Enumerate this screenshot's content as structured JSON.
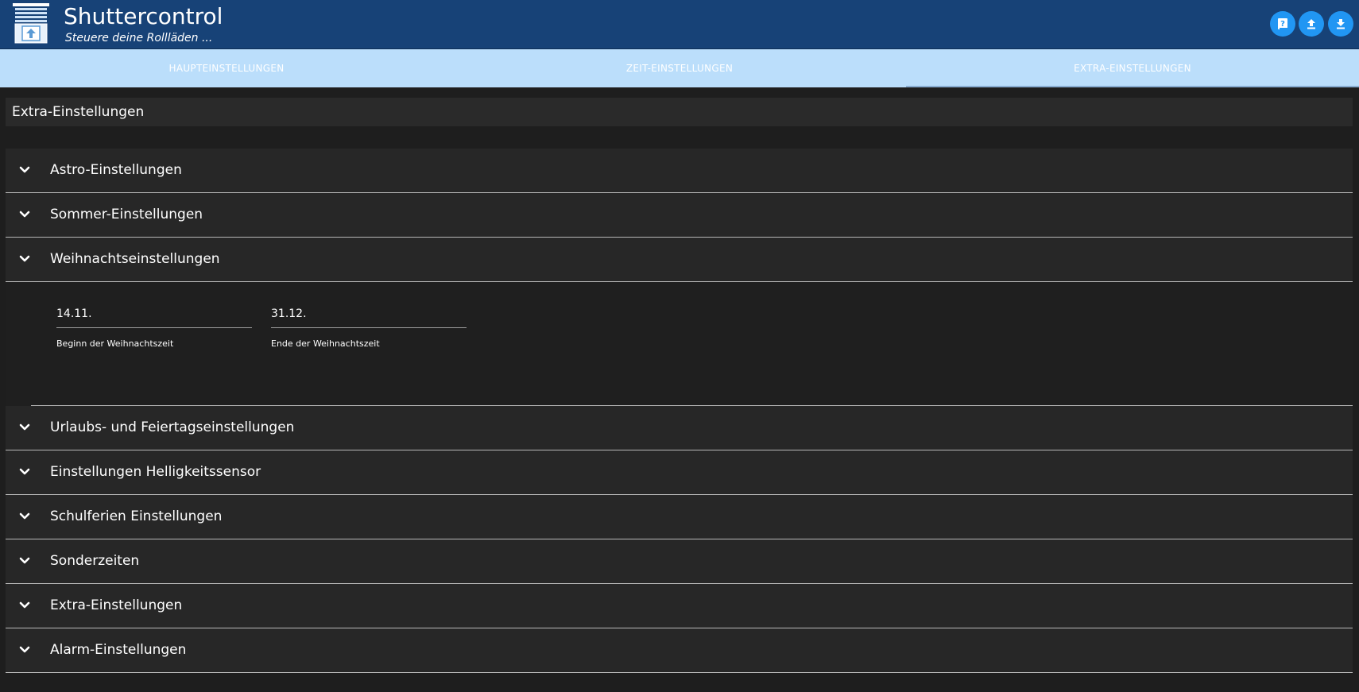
{
  "header": {
    "title": "Shuttercontrol",
    "subtitle": "Steuere deine Rollläden ...",
    "buttons": [
      {
        "name": "help",
        "icon": "help-book-icon"
      },
      {
        "name": "upload",
        "icon": "upload-icon"
      },
      {
        "name": "download",
        "icon": "download-icon"
      }
    ]
  },
  "tabs": [
    {
      "label": "HAUPTEINSTELLUNGEN",
      "active": false
    },
    {
      "label": "ZEIT-EINSTELLUNGEN",
      "active": false
    },
    {
      "label": "EXTRA-EINSTELLUNGEN",
      "active": true
    }
  ],
  "section_title": "Extra-Einstellungen",
  "accordion": {
    "items": [
      {
        "label": "Astro-Einstellungen",
        "expanded": false
      },
      {
        "label": "Sommer-Einstellungen",
        "expanded": false
      },
      {
        "label": "Weihnachtseinstellungen",
        "expanded": true
      },
      {
        "label": "Urlaubs- und Feiertagseinstellungen",
        "expanded": false
      },
      {
        "label": "Einstellungen Helligkeitssensor",
        "expanded": false
      },
      {
        "label": "Schulferien Einstellungen",
        "expanded": false
      },
      {
        "label": "Sonderzeiten",
        "expanded": false
      },
      {
        "label": "Extra-Einstellungen",
        "expanded": false
      },
      {
        "label": "Alarm-Einstellungen",
        "expanded": false
      }
    ],
    "christmas": {
      "start": {
        "value": "14.11.",
        "label": "Beginn der Weihnachtszeit"
      },
      "end": {
        "value": "31.12.",
        "label": "Ende der Weihnachtszeit"
      }
    }
  },
  "colors": {
    "header_bg": "#174277",
    "tab_bar_bg": "#bbdefb",
    "button_bg": "#2196f3",
    "page_bg": "#1e1e1e",
    "panel_bg": "#272727"
  }
}
